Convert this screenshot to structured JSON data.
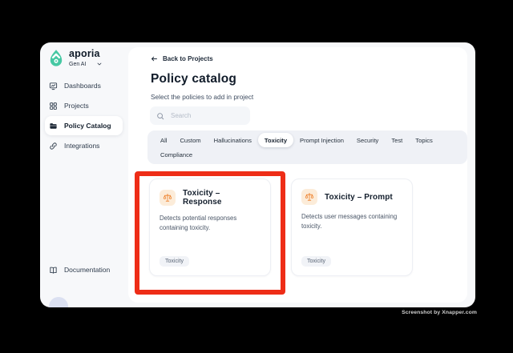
{
  "colors": {
    "highlight_red": "#EE2D17",
    "brand_teal": "#46C8A3",
    "policy_icon_orange": "#EF8A3B",
    "policy_icon_bg": "#FCECD9"
  },
  "sidebar": {
    "brand": "aporia",
    "workspace": "Gen AI",
    "items": [
      {
        "label": "Dashboards",
        "icon": "dashboards-icon",
        "active": false
      },
      {
        "label": "Projects",
        "icon": "projects-icon",
        "active": false
      },
      {
        "label": "Policy Catalog",
        "icon": "folder-icon",
        "active": true
      },
      {
        "label": "Integrations",
        "icon": "link-icon",
        "active": false
      }
    ],
    "documentation_label": "Documentation"
  },
  "main": {
    "back_link": "Back to Projects",
    "title": "Policy catalog",
    "subtitle": "Select the policies to add in project",
    "search": {
      "placeholder": "Search"
    },
    "tabs": [
      {
        "label": "All",
        "active": false
      },
      {
        "label": "Custom",
        "active": false
      },
      {
        "label": "Hallucinations",
        "active": false
      },
      {
        "label": "Toxicity",
        "active": true
      },
      {
        "label": "Prompt Injection",
        "active": false
      },
      {
        "label": "Security",
        "active": false
      },
      {
        "label": "Test",
        "active": false
      },
      {
        "label": "Topics",
        "active": false
      },
      {
        "label": "Compliance",
        "active": false
      }
    ],
    "cards": [
      {
        "title": "Toxicity – Response",
        "description": "Detects potential responses containing toxicity.",
        "tag": "Toxicity",
        "icon": "scales-icon",
        "highlighted": true
      },
      {
        "title": "Toxicity – Prompt",
        "description": "Detects user messages containing toxicity.",
        "tag": "Toxicity",
        "icon": "scales-icon",
        "highlighted": false
      }
    ]
  },
  "watermark": "Screenshot by Xnapper.com"
}
